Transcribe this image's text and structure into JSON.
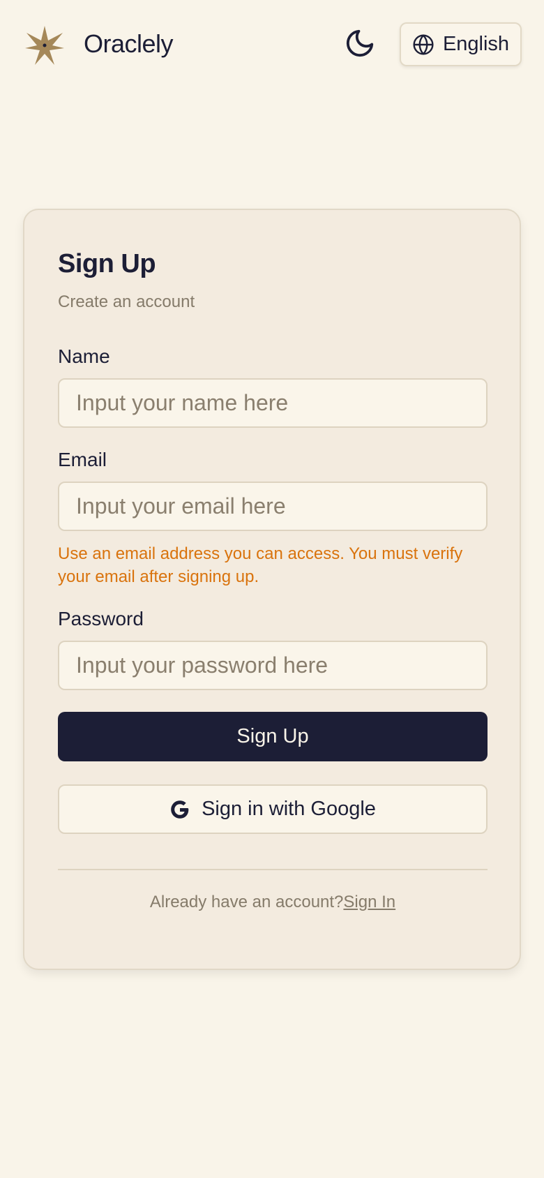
{
  "header": {
    "brand": "Oraclely",
    "language_label": "English"
  },
  "form": {
    "title": "Sign Up",
    "subtitle": "Create an account",
    "name": {
      "label": "Name",
      "placeholder": "Input your name here"
    },
    "email": {
      "label": "Email",
      "placeholder": "Input your email here",
      "hint": "Use an email address you can access. You must verify your email after signing up."
    },
    "password": {
      "label": "Password",
      "placeholder": "Input your password here"
    },
    "submit_label": "Sign Up",
    "google_label": "Sign in with Google",
    "footer_text": "Already have an account?",
    "signin_link": "Sign In"
  },
  "icons": {
    "logo": "star-logo-icon",
    "theme": "moon-icon",
    "language": "globe-icon",
    "google": "google-icon"
  },
  "colors": {
    "background": "#f9f4e9",
    "card": "#f3ebdf",
    "primary": "#1c1e36",
    "hint": "#d9730d",
    "logo": "#a58859",
    "muted": "#857b6a"
  }
}
